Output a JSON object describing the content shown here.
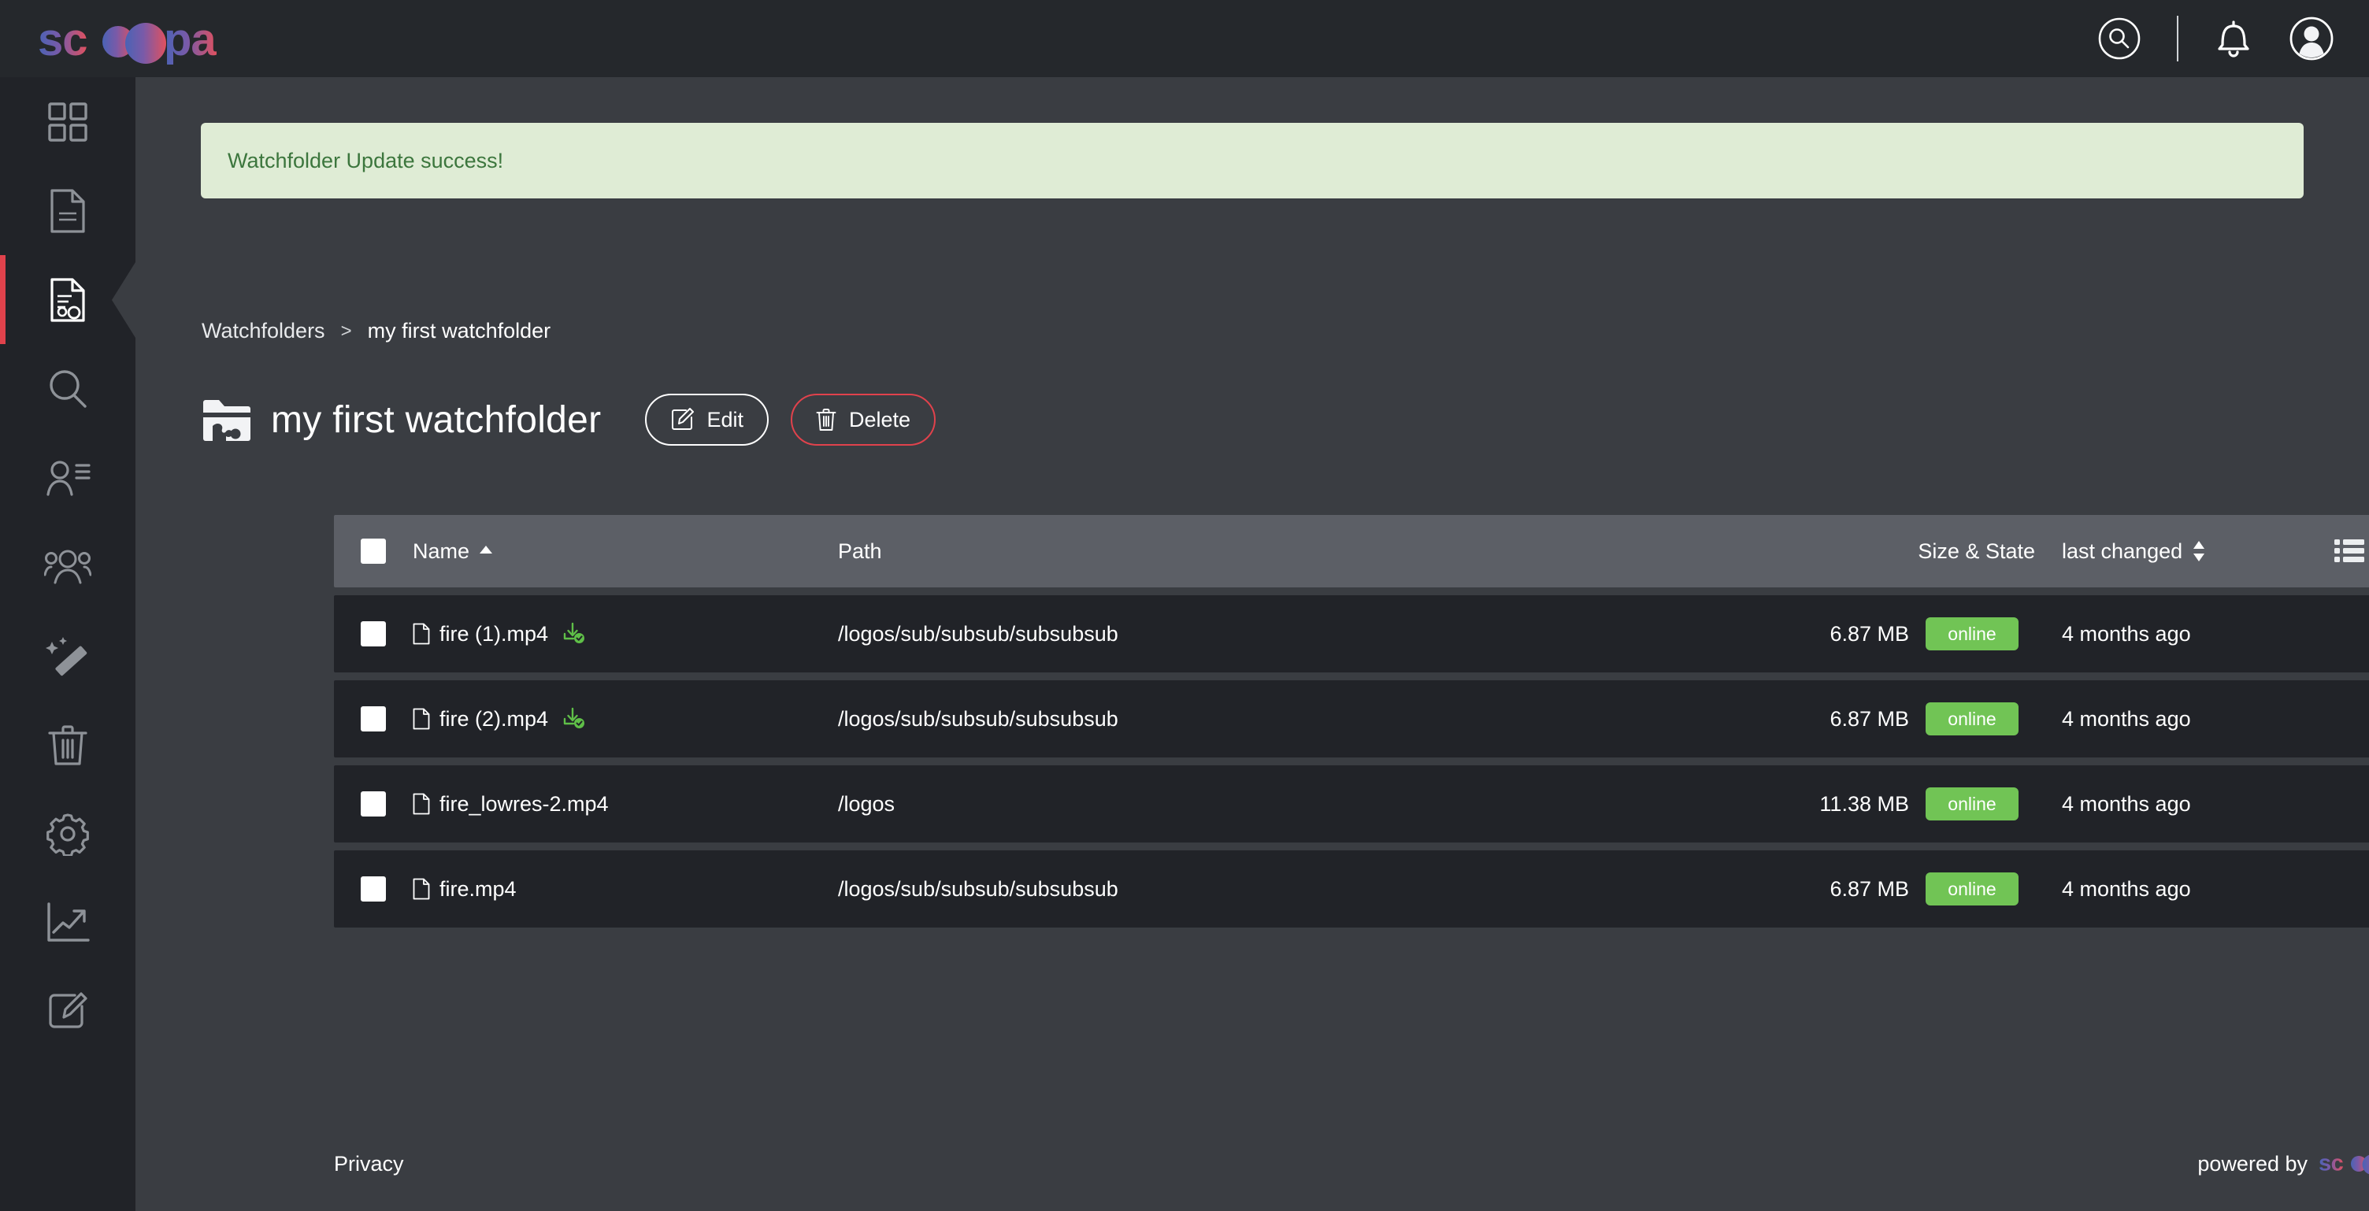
{
  "brand": {
    "name": "scoopa",
    "gradient_start": "#4a63b5",
    "gradient_end": "#e05060"
  },
  "topbar": {
    "search_icon": "search-icon",
    "bell_icon": "bell-icon",
    "avatar_icon": "user-avatar-icon"
  },
  "sidebar": {
    "items": [
      {
        "name": "dashboard",
        "icon": "grid-dashboard-icon",
        "active": false
      },
      {
        "name": "documents",
        "icon": "document-icon",
        "active": false
      },
      {
        "name": "watchfolders",
        "icon": "document-gear-icon",
        "active": true
      },
      {
        "name": "search",
        "icon": "search-icon",
        "active": false
      },
      {
        "name": "user-details",
        "icon": "user-list-icon",
        "active": false
      },
      {
        "name": "groups",
        "icon": "users-group-icon",
        "active": false
      },
      {
        "name": "magic",
        "icon": "magic-wand-icon",
        "active": false
      },
      {
        "name": "trash",
        "icon": "trash-icon",
        "active": false
      },
      {
        "name": "settings",
        "icon": "gear-icon",
        "active": false
      },
      {
        "name": "analytics",
        "icon": "chart-line-icon",
        "active": false
      },
      {
        "name": "editor",
        "icon": "edit-square-icon",
        "active": false
      }
    ]
  },
  "banner": {
    "message": "Watchfolder Update success!",
    "bg": "#dfecd5",
    "fg": "#3c763d"
  },
  "breadcrumb": {
    "root": "Watchfolders",
    "separator": ">",
    "current": "my first watchfolder"
  },
  "page": {
    "title": "my first watchfolder",
    "folder_icon": "watchfolder-icon",
    "edit_label": "Edit",
    "edit_icon": "pencil-square-icon",
    "delete_label": "Delete",
    "delete_icon": "trash-icon",
    "delete_color": "#e0424c"
  },
  "table": {
    "headers": {
      "name": "Name",
      "name_sort": "ascending",
      "path": "Path",
      "size_state": "Size & State",
      "last_changed": "last changed",
      "last_changed_sort": "none"
    },
    "view_toggles": [
      {
        "name": "list-view",
        "icon": "list-view-icon",
        "active": true
      },
      {
        "name": "grid-view",
        "icon": "grid-view-icon",
        "active": false
      }
    ],
    "rows": [
      {
        "name": "fire (1).mp4",
        "downloaded": true,
        "path": "/logos/sub/subsub/subsubsub",
        "size": "6.87 MB",
        "state": "online",
        "last_changed": "4 months ago"
      },
      {
        "name": "fire (2).mp4",
        "downloaded": true,
        "path": "/logos/sub/subsub/subsubsub",
        "size": "6.87 MB",
        "state": "online",
        "last_changed": "4 months ago"
      },
      {
        "name": "fire_lowres-2.mp4",
        "downloaded": false,
        "path": "/logos",
        "size": "11.38 MB",
        "state": "online",
        "last_changed": "4 months ago"
      },
      {
        "name": "fire.mp4",
        "downloaded": false,
        "path": "/logos/sub/subsub/subsubsub",
        "size": "6.87 MB",
        "state": "online",
        "last_changed": "4 months ago"
      }
    ]
  },
  "footer": {
    "privacy": "Privacy",
    "powered_by": "powered by",
    "brand": "scoopa"
  },
  "colors": {
    "topbar_bg": "#25282c",
    "sidebar_bg": "#212328",
    "content_bg": "#3a3d42",
    "row_bg": "#212328",
    "thead_bg": "#5c5f66",
    "badge_green": "#71c455",
    "active_bar": "#e0424c"
  }
}
